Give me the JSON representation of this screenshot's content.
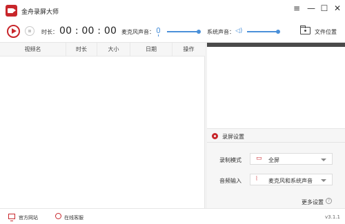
{
  "app": {
    "title": "金舟录屏大师"
  },
  "window_controls": {
    "menu": "≡",
    "minimize": "—",
    "maximize": "☐",
    "close": "✕"
  },
  "toolbar": {
    "duration_label": "时长：",
    "duration_value": "00 : 00 : 00",
    "mic_label": "麦克风声音：",
    "sys_label": "系统声音：",
    "mic_level": 1.0,
    "sys_level": 1.0,
    "folder_label": "文件位置"
  },
  "list": {
    "columns": [
      "视频名",
      "时长",
      "大小",
      "日期",
      "操作"
    ],
    "rows": []
  },
  "settings": {
    "title": "录屏设置",
    "mode_label": "录制模式",
    "mode_value": "全屏",
    "audio_label": "音频输入",
    "audio_value": "麦克风和系统声音",
    "more": "更多设置"
  },
  "status": {
    "website": "官方网站",
    "service": "在线客服",
    "version": "v3.1.1"
  },
  "colors": {
    "accent": "#c8262b",
    "slider": "#4a90d9"
  }
}
